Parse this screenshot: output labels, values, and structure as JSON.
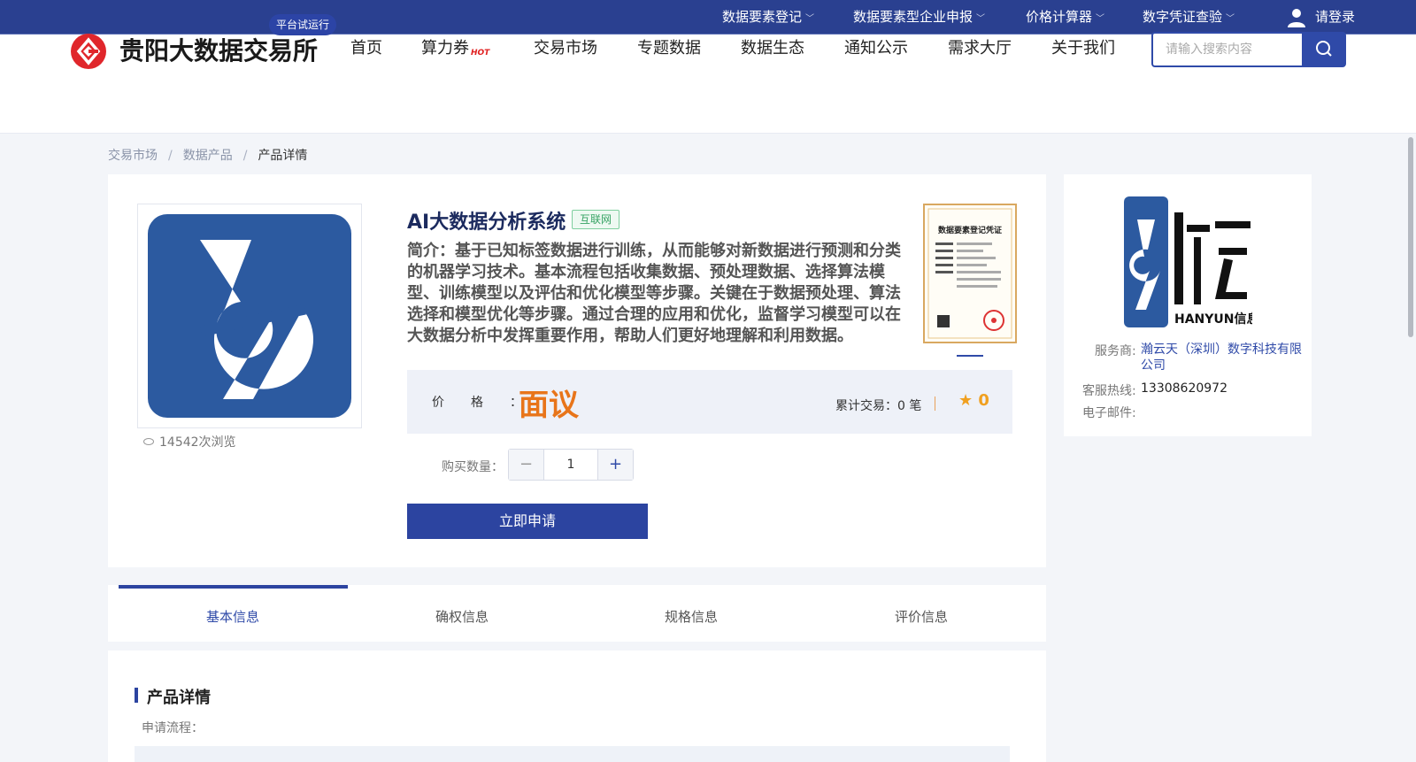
{
  "topbar": {
    "links": [
      {
        "label": "数据要素登记"
      },
      {
        "label": "数据要素型企业申报"
      },
      {
        "label": "价格计算器"
      },
      {
        "label": "数字凭证查验"
      }
    ],
    "login_label": "请登录"
  },
  "header": {
    "site_name": "贵阳大数据交易所",
    "badge": "平台试运行",
    "nav": [
      "首页",
      "算力券",
      "交易市场",
      "专题数据",
      "数据生态",
      "通知公示",
      "需求大厅",
      "关于我们"
    ],
    "hot_tag": "HOT",
    "search_placeholder": "请输入搜索内容"
  },
  "breadcrumb": [
    "交易市场",
    "数据产品",
    "产品详情"
  ],
  "product": {
    "title": "AI大数据分析系统",
    "tag": "互联网",
    "intro": "简介：基于已知标签数据进行训练，从而能够对新数据进行预测和分类的机器学习技术。基本流程包括收集数据、预处理数据、选择算法模型、训练模型以及评估和优化模型等步骤。关键在于数据预处理、算法选择和模型优化等步骤。通过合理的应用和优化，监督学习模型可以在大数据分析中发挥重要作用，帮助人们更好地理解和利用数据。",
    "views": "14542次浏览",
    "certificate_title": "数据要素登记凭证",
    "price_label": "价格：",
    "price_value": "面议",
    "trade_count": "累计交易：0 笔",
    "rating": "0",
    "qty_label": "购买数量：",
    "qty_value": "1",
    "apply_label": "立即申请"
  },
  "seller": {
    "logo_text": "HANYUN信息科技",
    "service_label": "服务商:",
    "service_value": "瀚云天（深圳）数字科技有限公司",
    "hotline_label": "客服热线:",
    "hotline_value": "13308620972",
    "email_label": "电子邮件:",
    "email_value": ""
  },
  "tabs": [
    "基本信息",
    "确权信息",
    "规格信息",
    "评价信息"
  ],
  "details": {
    "title": "产品详情",
    "process_label": "申请流程："
  },
  "colors": {
    "brand_blue": "#2c44a0",
    "price_orange": "#e8751a",
    "logo_red": "#e0262b"
  }
}
